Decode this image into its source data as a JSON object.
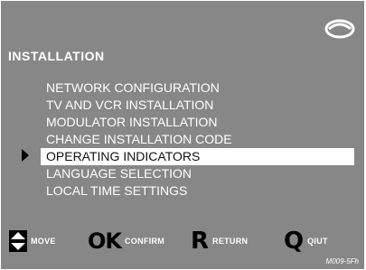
{
  "screen": {
    "background_color": "#878787",
    "logo_icon": "eye-logo-icon"
  },
  "menu": {
    "title": "INSTALLATION",
    "items": [
      {
        "label": "NETWORK CONFIGURATION",
        "selected": false
      },
      {
        "label": "TV AND VCR INSTALLATION",
        "selected": false
      },
      {
        "label": "MODULATOR INSTALLATION",
        "selected": false
      },
      {
        "label": "CHANGE INSTALLATION CODE",
        "selected": false
      },
      {
        "label": "OPERATING INDICATORS",
        "selected": true
      },
      {
        "label": "LANGUAGE SELECTION",
        "selected": false
      },
      {
        "label": "LOCAL TIME SETTINGS",
        "selected": false
      }
    ],
    "cursor_icon": "triangle-right-icon"
  },
  "controls": {
    "move": {
      "icon": "up-down-arrow-icon",
      "label": "MOVE"
    },
    "confirm": {
      "key": "OK",
      "label": "CONFIRM"
    },
    "return": {
      "key": "R",
      "label": "RETURN"
    },
    "quit": {
      "key": "Q",
      "label": "QIUT"
    }
  },
  "reference_code": "M009-5Fh"
}
